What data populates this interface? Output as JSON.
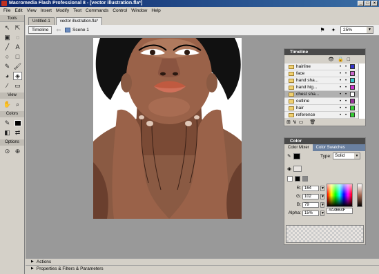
{
  "window": {
    "title": "Macromedia Flash Professional 8 - [vector illustration.fla*]",
    "controls": [
      "_",
      "□",
      "×"
    ]
  },
  "menu": [
    "File",
    "Edit",
    "View",
    "Insert",
    "Modify",
    "Text",
    "Commands",
    "Control",
    "Window",
    "Help"
  ],
  "tools": {
    "label": "Tools",
    "view_label": "View",
    "colors_label": "Colors",
    "options_label": "Options"
  },
  "tabs": [
    "Untitled-1",
    "vector illustration.fla*"
  ],
  "editbar": {
    "timeline_button": "Timeline",
    "scene": "Scene 1",
    "zoom": "25%"
  },
  "timeline": {
    "title": "Timeline",
    "layers": [
      {
        "name": "hairline",
        "color": "#3333cc",
        "selected": false
      },
      {
        "name": "face",
        "color": "#cc66cc",
        "selected": false
      },
      {
        "name": "hand sha...",
        "color": "#33cccc",
        "selected": false
      },
      {
        "name": "hand hig...",
        "color": "#cc33cc",
        "selected": false
      },
      {
        "name": "chest sha...",
        "color": "#ffffff",
        "selected": true
      },
      {
        "name": "outline",
        "color": "#993399",
        "selected": false
      },
      {
        "name": "hair",
        "color": "#33cc33",
        "selected": false
      },
      {
        "name": "reference",
        "color": "#33cc33",
        "selected": false
      }
    ]
  },
  "color_panel": {
    "title": "Color",
    "tab_mixer": "Color Mixer",
    "tab_swatches": "Color Swatches",
    "type_label": "Type:",
    "type_value": "Solid",
    "r_label": "R:",
    "r_value": "164",
    "g_label": "G:",
    "g_value": "102",
    "b_label": "B:",
    "b_value": "79",
    "alpha_label": "Alpha:",
    "alpha_value": "15%",
    "hex": "#A4664F",
    "swatch_color": "#a4664f"
  },
  "bottom_panels": [
    "Actions",
    "Properties & Filters & Parameters"
  ]
}
